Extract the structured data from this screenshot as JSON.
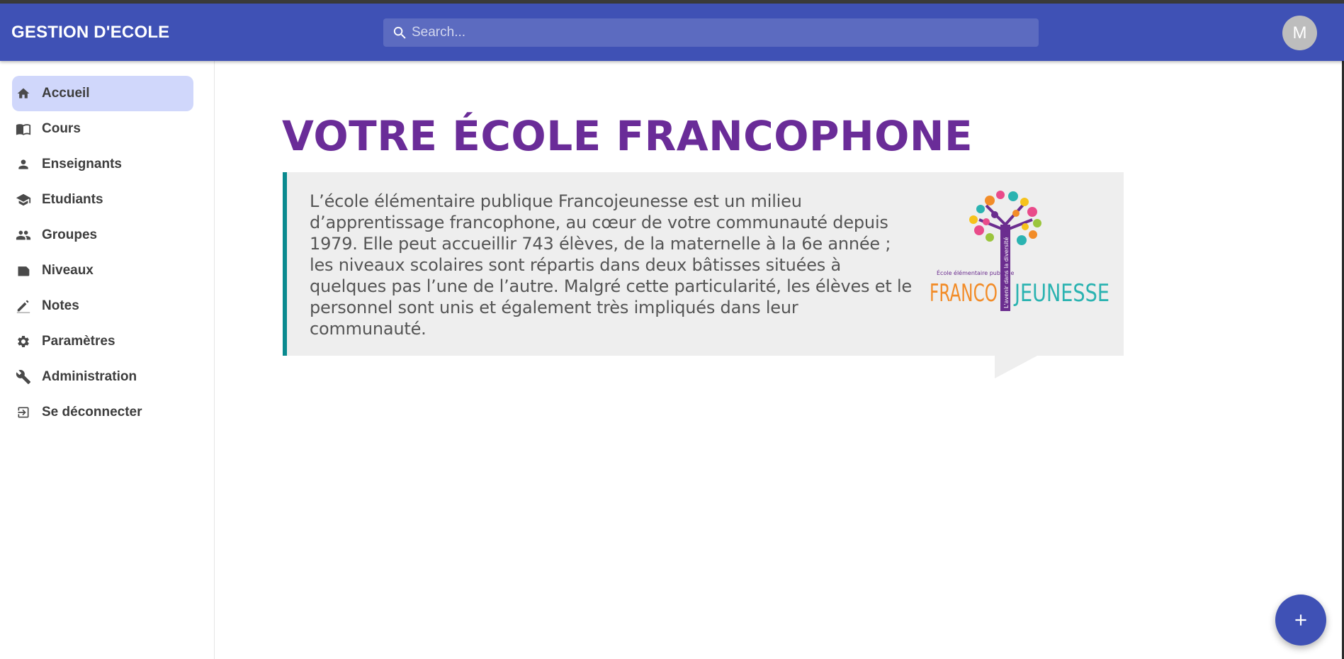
{
  "app": {
    "title": "GESTION D'ECOLE"
  },
  "search": {
    "placeholder": "Search..."
  },
  "user": {
    "initial": "M"
  },
  "sidebar": {
    "items": [
      {
        "label": "Accueil",
        "icon": "home-icon",
        "active": true
      },
      {
        "label": "Cours",
        "icon": "book-icon"
      },
      {
        "label": "Enseignants",
        "icon": "person-icon"
      },
      {
        "label": "Etudiants",
        "icon": "school-icon"
      },
      {
        "label": "Groupes",
        "icon": "group-icon"
      },
      {
        "label": "Niveaux",
        "icon": "label-icon"
      },
      {
        "label": "Notes",
        "icon": "edit-icon"
      },
      {
        "label": "Paramètres",
        "icon": "gear-icon"
      },
      {
        "label": "Administration",
        "icon": "wrench-icon"
      },
      {
        "label": "Se déconnecter",
        "icon": "logout-icon"
      }
    ]
  },
  "main": {
    "heading": "VOTRE ÉCOLE FRANCOPHONE",
    "paragraph": "L’école élémentaire publique Francojeunesse est un milieu d’apprentissage francophone, au cœur de votre communauté depuis 1979. Elle peut  accueillir 743 élèves, de la maternelle à la 6e année ; les niveaux scolaires sont répartis dans deux bâtisses situées à quelques pas l’une de l’autre. Malgré cette particularité, les élèves et le personnel sont unis et également très impliqués dans leur communauté.",
    "logo": {
      "small_text": "École élémentaire publique",
      "word_left": "FRANCO",
      "word_right": "JEUNESSE",
      "trunk_text": "L'avenir dans la diversité"
    }
  },
  "colors": {
    "appbar": "#3f51b5",
    "search": "#5c6bc0",
    "active_nav": "#d0d7fb",
    "heading": "#6a2c98",
    "card_border": "#0a8a8f",
    "fab": "#3f51b5"
  },
  "fab": {
    "icon": "plus-icon"
  }
}
